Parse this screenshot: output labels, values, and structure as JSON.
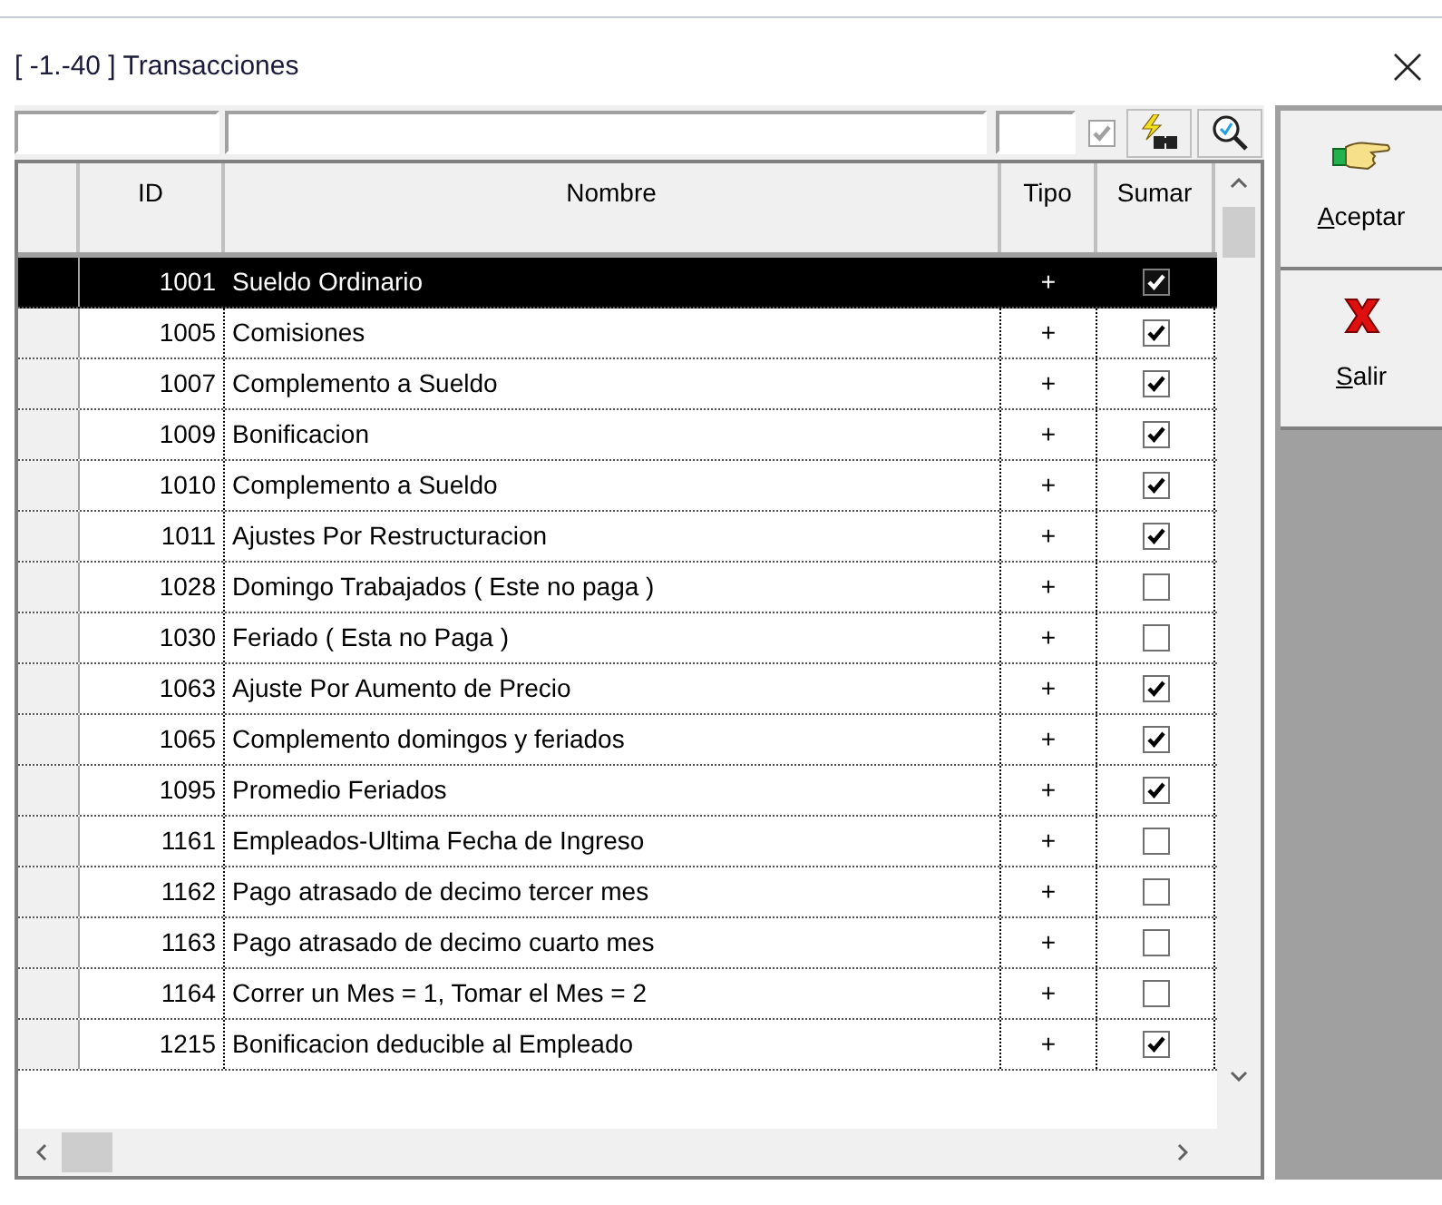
{
  "window": {
    "title": "[ -1.-40 ] Transacciones"
  },
  "filters": {
    "checkbox": {
      "checked": true,
      "disabled": true
    }
  },
  "table": {
    "columns": [
      "ID",
      "Nombre",
      "Tipo",
      "Sumar"
    ],
    "rows": [
      {
        "id": "1001",
        "nombre": "Sueldo Ordinario",
        "tipo": "+",
        "sumar": true,
        "selected": true
      },
      {
        "id": "1005",
        "nombre": "Comisiones",
        "tipo": "+",
        "sumar": true,
        "selected": false
      },
      {
        "id": "1007",
        "nombre": "Complemento a Sueldo",
        "tipo": "+",
        "sumar": true,
        "selected": false
      },
      {
        "id": "1009",
        "nombre": "Bonificacion",
        "tipo": "+",
        "sumar": true,
        "selected": false
      },
      {
        "id": "1010",
        "nombre": "Complemento a Sueldo",
        "tipo": "+",
        "sumar": true,
        "selected": false
      },
      {
        "id": "1011",
        "nombre": "Ajustes Por Restructuracion",
        "tipo": "+",
        "sumar": true,
        "selected": false
      },
      {
        "id": "1028",
        "nombre": "Domingo Trabajados ( Este no paga )",
        "tipo": "+",
        "sumar": false,
        "selected": false
      },
      {
        "id": "1030",
        "nombre": "Feriado ( Esta no Paga )",
        "tipo": "+",
        "sumar": false,
        "selected": false
      },
      {
        "id": "1063",
        "nombre": "Ajuste Por Aumento de Precio",
        "tipo": "+",
        "sumar": true,
        "selected": false
      },
      {
        "id": "1065",
        "nombre": "Complemento domingos y feriados",
        "tipo": "+",
        "sumar": true,
        "selected": false
      },
      {
        "id": "1095",
        "nombre": "Promedio Feriados",
        "tipo": "+",
        "sumar": true,
        "selected": false
      },
      {
        "id": "1161",
        "nombre": "Empleados-Ultima Fecha de Ingreso",
        "tipo": "+",
        "sumar": false,
        "selected": false
      },
      {
        "id": "1162",
        "nombre": "Pago atrasado de decimo tercer mes",
        "tipo": "+",
        "sumar": false,
        "selected": false
      },
      {
        "id": "1163",
        "nombre": "Pago atrasado de decimo cuarto mes",
        "tipo": "+",
        "sumar": false,
        "selected": false
      },
      {
        "id": "1164",
        "nombre": "Correr un Mes = 1, Tomar el Mes = 2",
        "tipo": "+",
        "sumar": false,
        "selected": false
      },
      {
        "id": "1215",
        "nombre": "Bonificacion deducible al Empleado",
        "tipo": "+",
        "sumar": true,
        "selected": false
      }
    ]
  },
  "buttons": [
    {
      "kind": "accept",
      "label": "Aceptar"
    },
    {
      "kind": "exit",
      "label": "Salir"
    }
  ]
}
